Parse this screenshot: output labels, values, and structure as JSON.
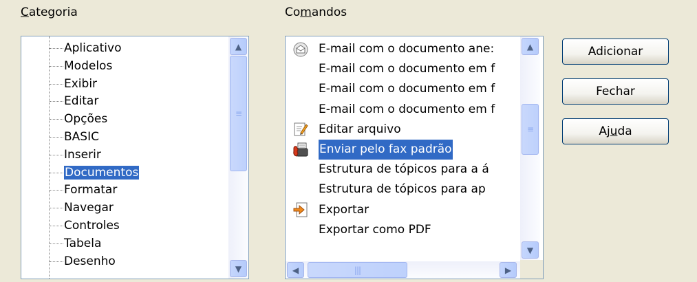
{
  "category": {
    "label_accel": "C",
    "label_rest": "ategoria",
    "items": [
      "Aplicativo",
      "Modelos",
      "Exibir",
      "Editar",
      "Opções",
      "BASIC",
      "Inserir",
      "Documentos",
      "Formatar",
      "Navegar",
      "Controles",
      "Tabela",
      "Desenho"
    ],
    "selected_index": 7
  },
  "commands": {
    "label_pre": "Co",
    "label_accel": "m",
    "label_post": "andos",
    "items": [
      {
        "label": "E-mail com o documento ane:",
        "icon": "email-icon"
      },
      {
        "label": "E-mail com o documento em f",
        "icon": ""
      },
      {
        "label": "E-mail com o documento em f",
        "icon": ""
      },
      {
        "label": "E-mail com o documento em f",
        "icon": ""
      },
      {
        "label": "Editar arquivo",
        "icon": "edit-file-icon"
      },
      {
        "label": "Enviar pelo fax padrão",
        "icon": "fax-icon"
      },
      {
        "label": "Estrutura de tópicos para a á",
        "icon": ""
      },
      {
        "label": "Estrutura de tópicos para ap",
        "icon": ""
      },
      {
        "label": "Exportar",
        "icon": "export-icon"
      },
      {
        "label": "Exportar como PDF",
        "icon": ""
      }
    ],
    "selected_index": 5
  },
  "buttons": {
    "add": "Adicionar",
    "close": "Fechar",
    "help_pre": "Aj",
    "help_accel": "u",
    "help_post": "da"
  },
  "colors": {
    "selection": "#316ac5",
    "dialog_bg": "#ece9d8",
    "border": "#7f9db9"
  }
}
